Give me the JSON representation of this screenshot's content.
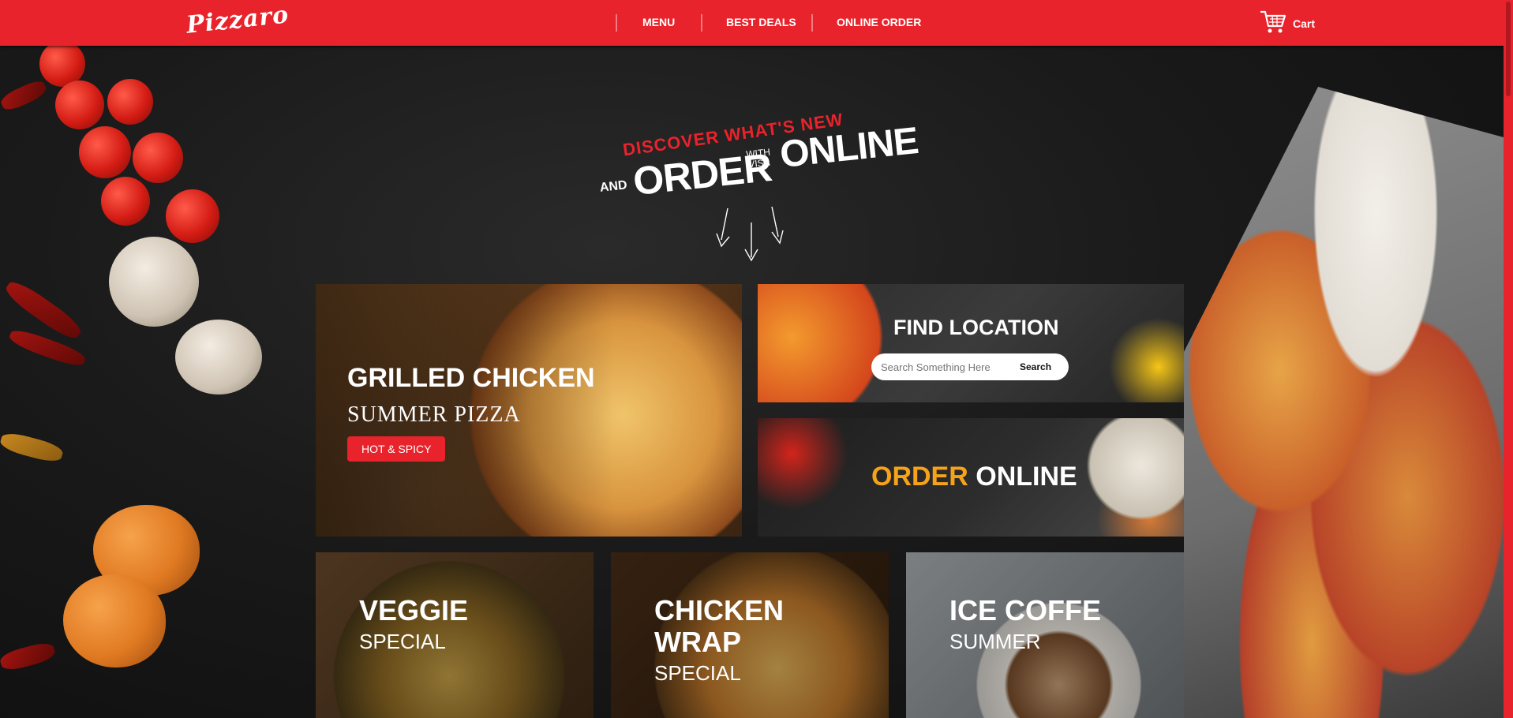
{
  "brand": {
    "logo_text": "Pizzaro"
  },
  "nav": {
    "items": [
      {
        "label": "MENU"
      },
      {
        "label": "BEST DEALS"
      },
      {
        "label": "ONLINE ORDER"
      }
    ],
    "cart_label": "Cart",
    "cart_icon": "shopping-cart-icon"
  },
  "hero": {
    "discover": "DISCOVER WHAT'S NEW",
    "and": "AND",
    "order": "ORDER",
    "with_visa_line1": "WITH",
    "with_visa_line2": "VISA",
    "online": "ONLINE"
  },
  "promo_grilled": {
    "title": "GRILLED CHICKEN",
    "subtitle": "SUMMER PIZZA",
    "button": "HOT & SPICY"
  },
  "find_location": {
    "title": "FIND LOCATION",
    "search_placeholder": "Search Something Here",
    "search_button": "Search"
  },
  "order_online": {
    "accent_word": "ORDER",
    "word": "ONLINE"
  },
  "bottom_cards": [
    {
      "title": "VEGGIE",
      "subtitle": "SPECIAL"
    },
    {
      "title_line1": "CHICKEN",
      "title_line2": "WRAP",
      "subtitle": "SPECIAL"
    },
    {
      "title": "ICE COFFE",
      "subtitle": "SUMMER"
    }
  ],
  "colors": {
    "brand_red": "#e8232c",
    "accent_orange": "#f5a31a",
    "background": "#141414"
  }
}
